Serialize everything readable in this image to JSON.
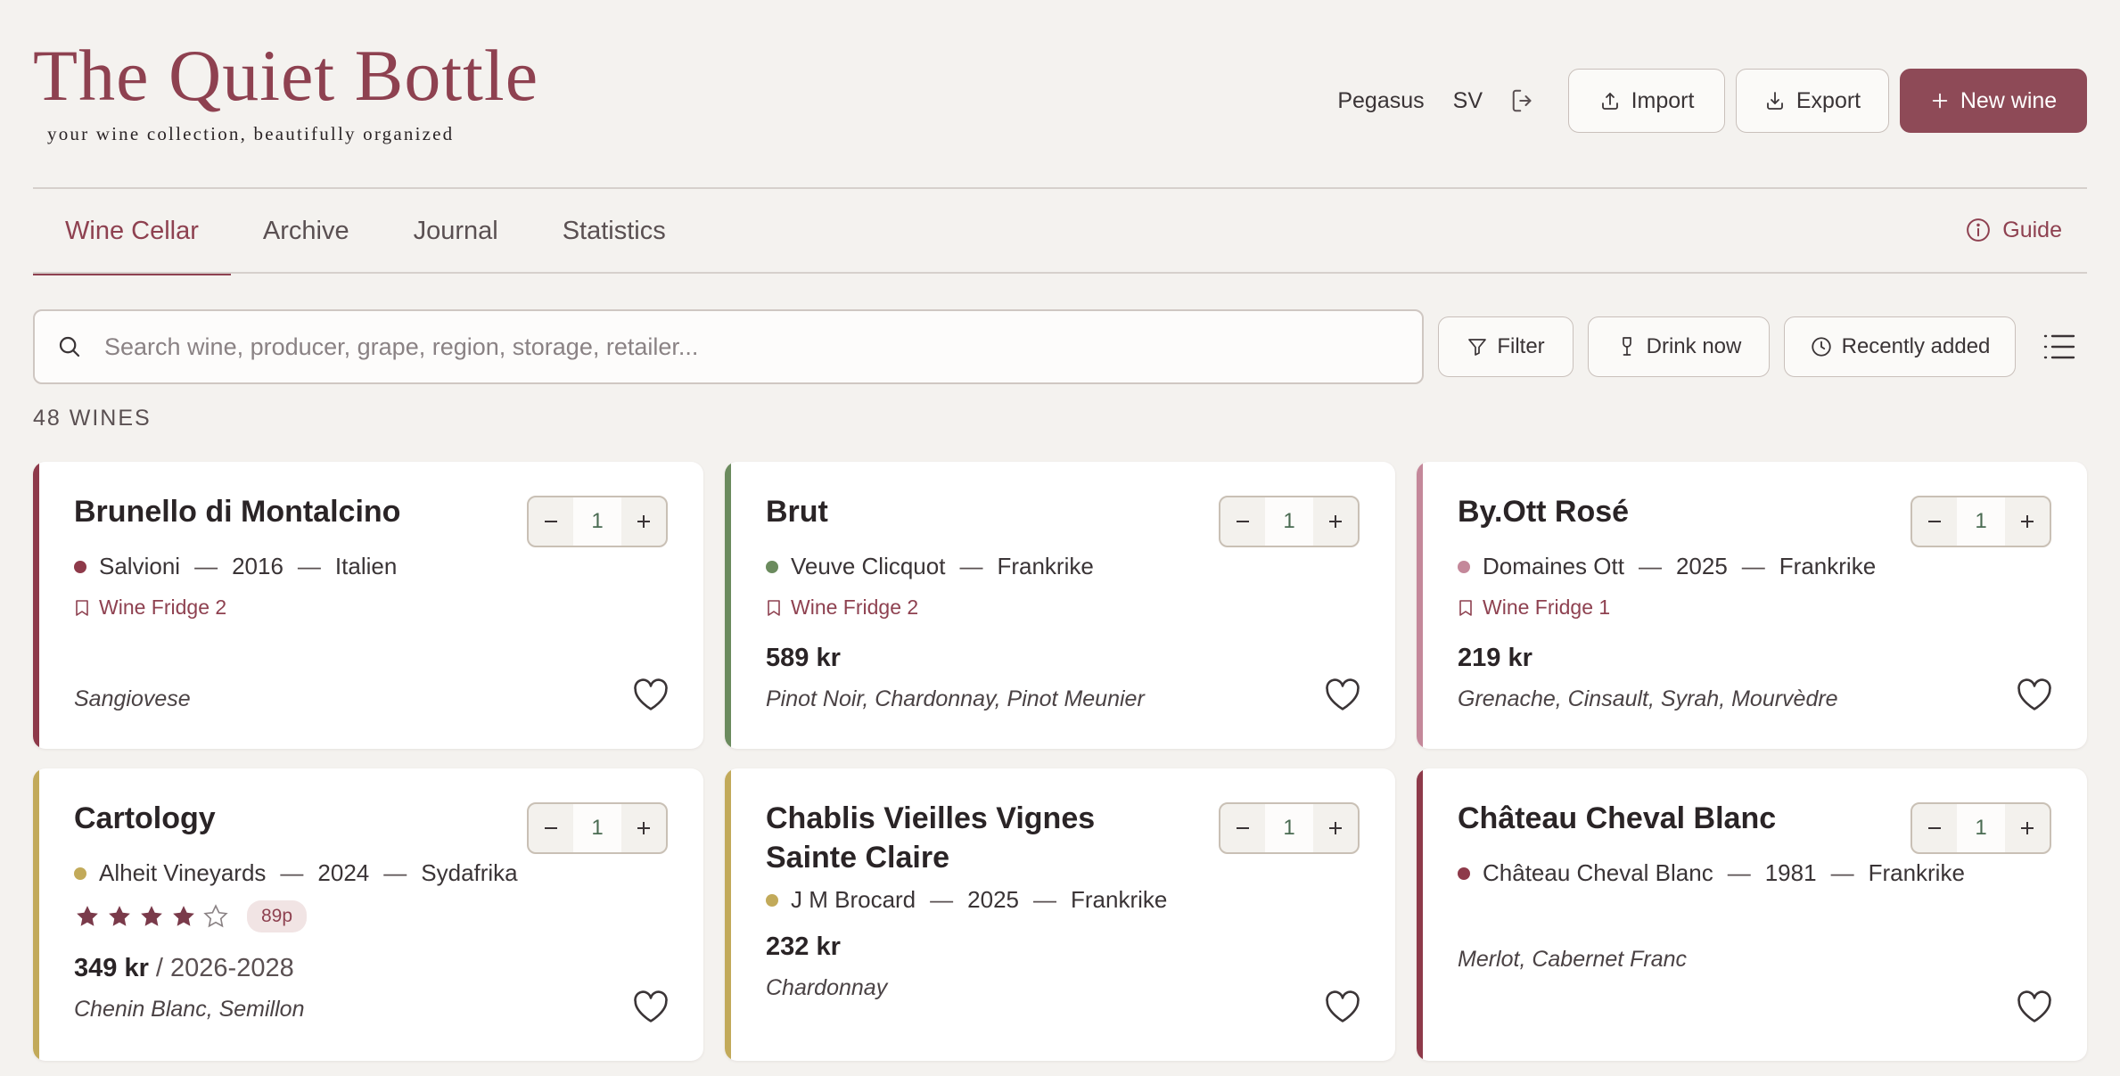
{
  "brand": {
    "title": "The Quiet Bottle",
    "tagline": "your wine collection, beautifully organized"
  },
  "header": {
    "user": "Pegasus",
    "language": "SV",
    "logout_icon": "logout-icon",
    "import_label": "Import",
    "export_label": "Export",
    "new_wine_label": "New wine"
  },
  "nav": {
    "tabs": [
      {
        "label": "Wine Cellar",
        "active": true
      },
      {
        "label": "Archive",
        "active": false
      },
      {
        "label": "Journal",
        "active": false
      },
      {
        "label": "Statistics",
        "active": false
      }
    ],
    "guide_label": "Guide"
  },
  "search": {
    "placeholder": "Search wine, producer, grape, region, storage, retailer...",
    "value": ""
  },
  "toolbar": {
    "filter_label": "Filter",
    "drink_now_label": "Drink now",
    "recently_added_label": "Recently added"
  },
  "count_label": "48 WINES",
  "colors": {
    "brand": "#8e4150",
    "red": "#8e3a4a",
    "sparkling": "#6b8b5e",
    "rose": "#c4889a",
    "white": "#c2aa5a"
  },
  "wines": [
    {
      "name": "Brunello di Montalcino",
      "quantity": "1",
      "producer": "Salvioni",
      "vintage": "2016",
      "country": "Italien",
      "storage": "Wine Fridge 2",
      "price": "",
      "grapes": "Sangiovese",
      "type": "red"
    },
    {
      "name": "Brut",
      "quantity": "1",
      "producer": "Veuve Clicquot",
      "vintage": "",
      "country": "Frankrike",
      "storage": "Wine Fridge 2",
      "price": "589 kr",
      "grapes": "Pinot Noir, Chardonnay, Pinot Meunier",
      "type": "sparkling"
    },
    {
      "name": "By.Ott Rosé",
      "quantity": "1",
      "producer": "Domaines Ott",
      "vintage": "2025",
      "country": "Frankrike",
      "storage": "Wine Fridge 1",
      "price": "219 kr",
      "grapes": "Grenache, Cinsault, Syrah, Mourvèdre",
      "type": "rose"
    },
    {
      "name": "Cartology",
      "quantity": "1",
      "producer": "Alheit Vineyards",
      "vintage": "2024",
      "country": "Sydafrika",
      "storage": "",
      "rating": 4,
      "rating_max": 5,
      "points": "89p",
      "price": "349 kr",
      "drink_window": "/ 2026-2028",
      "grapes": "Chenin Blanc, Semillon",
      "type": "white"
    },
    {
      "name": "Chablis Vieilles Vignes Sainte Claire",
      "quantity": "1",
      "producer": "J M Brocard",
      "vintage": "2025",
      "country": "Frankrike",
      "storage": "",
      "price": "232 kr",
      "grapes": "Chardonnay",
      "type": "white"
    },
    {
      "name": "Château Cheval Blanc",
      "quantity": "1",
      "producer": "Château Cheval Blanc",
      "vintage": "1981",
      "country": "Frankrike",
      "storage": "",
      "price": "",
      "grapes": "Merlot, Cabernet Franc",
      "type": "red"
    }
  ]
}
